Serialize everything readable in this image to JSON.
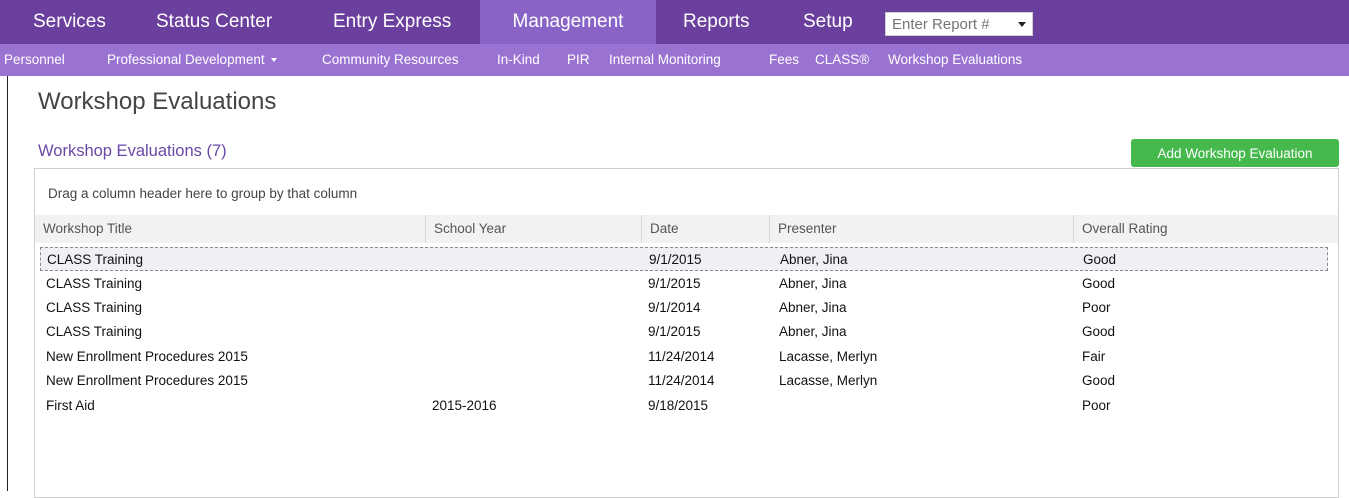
{
  "topnav": {
    "items": [
      {
        "label": "Services"
      },
      {
        "label": "Status Center"
      },
      {
        "label": "Entry Express"
      },
      {
        "label": "Management"
      },
      {
        "label": "Reports"
      },
      {
        "label": "Setup"
      }
    ],
    "active": "Management",
    "report_placeholder": "Enter Report #"
  },
  "subnav": {
    "items": [
      {
        "label": "Personnel"
      },
      {
        "label": "Professional Development"
      },
      {
        "label": "Community Resources"
      },
      {
        "label": "In-Kind"
      },
      {
        "label": "PIR"
      },
      {
        "label": "Internal Monitoring"
      },
      {
        "label": "Fees"
      },
      {
        "label": "CLASS®"
      },
      {
        "label": "Workshop Evaluations"
      }
    ]
  },
  "page": {
    "title": "Workshop Evaluations",
    "section_title": "Workshop Evaluations (7)",
    "add_button": "Add Workshop Evaluation"
  },
  "grid": {
    "group_hint": "Drag a column header here to group by that column",
    "columns": [
      "Workshop Title",
      "School Year",
      "Date",
      "Presenter",
      "Overall Rating"
    ],
    "rows": [
      {
        "title": "CLASS Training",
        "year": "",
        "date": "9/1/2015",
        "presenter": "Abner, Jina",
        "rating": "Good"
      },
      {
        "title": "CLASS Training",
        "year": "",
        "date": "9/1/2015",
        "presenter": "Abner, Jina",
        "rating": "Good"
      },
      {
        "title": "CLASS Training",
        "year": "",
        "date": "9/1/2014",
        "presenter": "Abner, Jina",
        "rating": "Poor"
      },
      {
        "title": "CLASS Training",
        "year": "",
        "date": "9/1/2015",
        "presenter": "Abner, Jina",
        "rating": "Good"
      },
      {
        "title": "New Enrollment Procedures 2015",
        "year": "",
        "date": "11/24/2014",
        "presenter": "Lacasse, Merlyn",
        "rating": "Fair"
      },
      {
        "title": "New Enrollment Procedures 2015",
        "year": "",
        "date": "11/24/2014",
        "presenter": "Lacasse, Merlyn",
        "rating": "Good"
      },
      {
        "title": "First Aid",
        "year": "2015-2016",
        "date": "9/18/2015",
        "presenter": "",
        "rating": "Poor"
      }
    ]
  },
  "colors": {
    "topnav_bg": "#6b3f9e",
    "topnav_active_bg": "#8a63c6",
    "subnav_bg": "#9a73d2",
    "accent_text": "#6a48a6",
    "add_button_bg": "#45b94c"
  }
}
